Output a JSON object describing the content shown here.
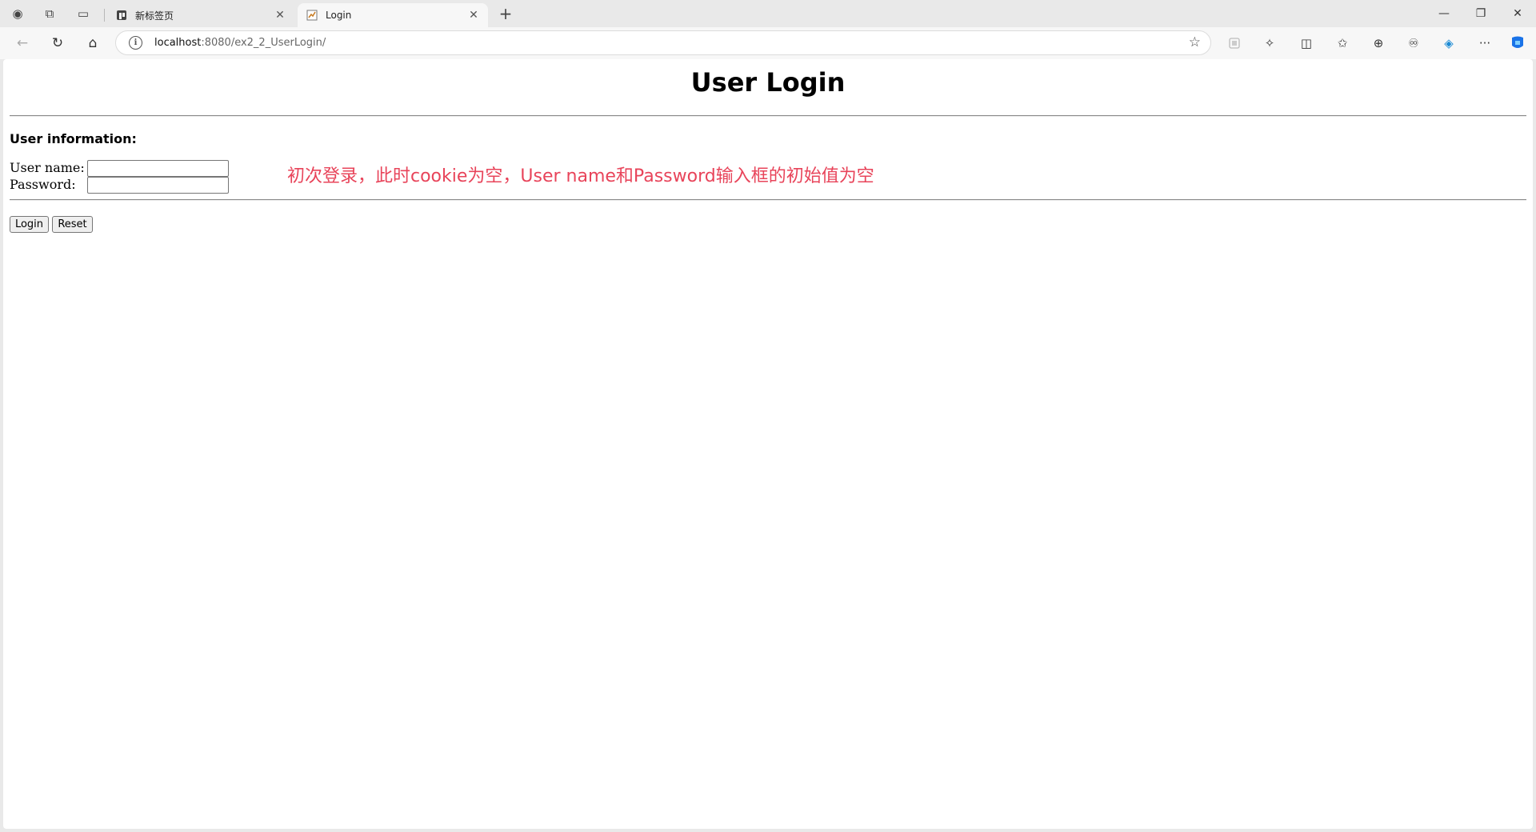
{
  "browser": {
    "tabs": [
      {
        "label": "新标签页",
        "close": "✕",
        "favicon": "newtab-favicon-icon"
      },
      {
        "label": "Login",
        "close": "✕",
        "favicon": "page-favicon-icon"
      }
    ],
    "new_tab": "+",
    "address": {
      "host": "localhost",
      "rest": ":8080/ex2_2_UserLogin/"
    },
    "icons": {
      "profile": "◉",
      "workspaces": "⧉",
      "tab_actions": "▭",
      "back": "←",
      "refresh": "↻",
      "home": "⌂",
      "info": "i",
      "favorite": "☆",
      "extensions": "✧",
      "split": "◫",
      "favorites": "✩",
      "collections": "⊕",
      "games": "♾",
      "browser_essentials": "◈",
      "more": "···",
      "copilot": "◆",
      "minimize": "—",
      "maximize": "❐",
      "close": "✕"
    }
  },
  "page": {
    "title": "User Login",
    "section_title": "User information:",
    "username_label": "User name:",
    "password_label": "Password:",
    "username_value": "",
    "password_value": "",
    "login_button": "Login",
    "reset_button": "Reset",
    "note": "初次登录，此时cookie为空，User name和Password输入框的初始值为空"
  },
  "colors": {
    "note": "#e8445a",
    "copilot": "#1a73e8"
  }
}
